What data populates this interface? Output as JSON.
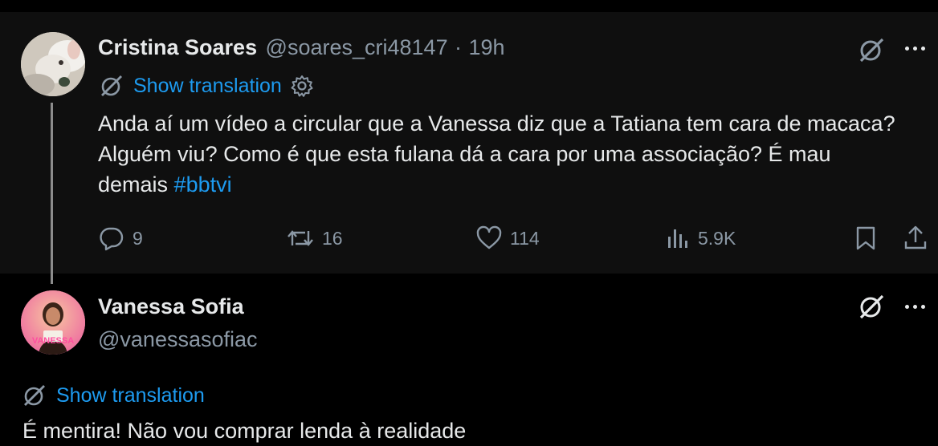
{
  "tweet1": {
    "author_name": "Cristina Soares",
    "author_handle": "@soares_cri48147",
    "separator": "·",
    "time": "19h",
    "show_translation": "Show translation",
    "text_main": "Anda aí um vídeo a circular que a Vanessa diz que a Tatiana tem cara de macaca? Alguém viu? Como é que esta fulana dá a cara por uma associação? É mau demais ",
    "hashtag": "#bbtvi",
    "replies": "9",
    "reposts": "16",
    "likes": "114",
    "views": "5.9K"
  },
  "tweet2": {
    "author_name": "Vanessa Sofia",
    "author_handle": "@vanessasofiac",
    "avatar_text": "VANESSA",
    "show_translation": "Show translation",
    "text_partial": "É mentira! Não vou comprar lenda à realidade"
  },
  "icons": {
    "grok": "grok-icon",
    "more": "more-icon",
    "translate": "translate-icon",
    "gear": "gear-icon",
    "reply": "reply-icon",
    "repost": "repost-icon",
    "like": "like-icon",
    "views": "views-icon",
    "bookmark": "bookmark-icon",
    "share": "share-icon"
  },
  "colors": {
    "accent": "#1d9bf0",
    "muted": "#8b98a5",
    "text": "#e7e9ea",
    "background": "#000000",
    "highlighted_bg": "#0f0f0f"
  }
}
